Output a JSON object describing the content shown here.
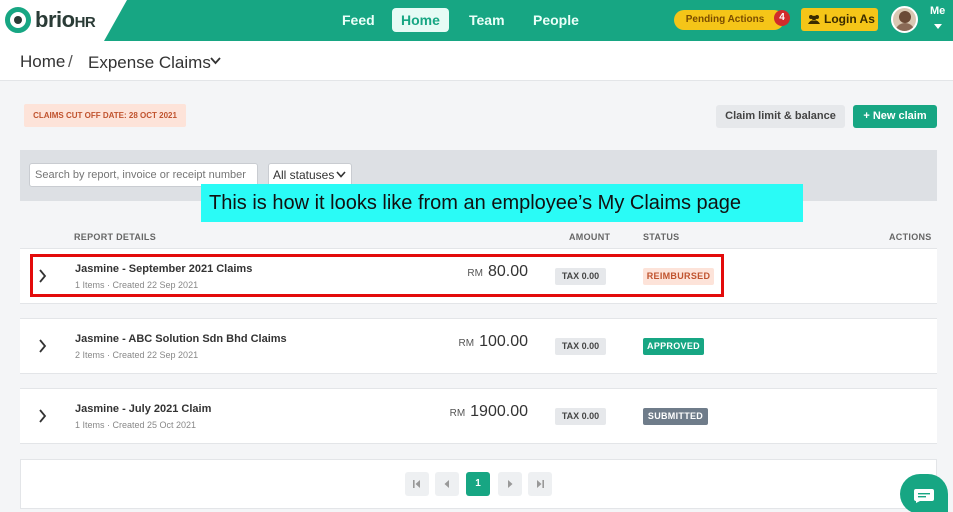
{
  "brand": {
    "name": "brio",
    "suffix": "HR"
  },
  "nav": {
    "feed": "Feed",
    "home": "Home",
    "team": "Team",
    "people": "People"
  },
  "header": {
    "pending_label": "Pending Actions",
    "pending_count": "4",
    "login_as": "Login As",
    "me": "Me"
  },
  "breadcrumb": {
    "home": "Home",
    "sep": "/",
    "page": "Expense Claims"
  },
  "toolbar": {
    "cutoff": "CLAIMS CUT OFF DATE: 28 OCT 2021",
    "limit_button": "Claim limit & balance",
    "new_button": "+ New claim"
  },
  "filter": {
    "search_placeholder": "Search by report, invoice or receipt number",
    "status_value": "All statuses"
  },
  "callout": "This is how it looks like from an employee’s My Claims page",
  "table": {
    "headers": {
      "details": "REPORT DETAILS",
      "amount": "AMOUNT",
      "status": "STATUS",
      "actions": "ACTIONS"
    },
    "rows": [
      {
        "title": "Jasmine - September 2021 Claims",
        "sub": "1 Items · Created 22 Sep 2021",
        "currency": "RM",
        "amount": "80.00",
        "tax": "TAX 0.00",
        "status": "REIMBURSED"
      },
      {
        "title": "Jasmine - ABC Solution Sdn Bhd Claims",
        "sub": "2 Items · Created 22 Sep 2021",
        "currency": "RM",
        "amount": "100.00",
        "tax": "TAX 0.00",
        "status": "APPROVED"
      },
      {
        "title": "Jasmine - July 2021 Claim",
        "sub": "1 Items · Created 25 Oct 2021",
        "currency": "RM",
        "amount": "1900.00",
        "tax": "TAX 0.00",
        "status": "SUBMITTED"
      }
    ]
  },
  "pagination": {
    "current": "1"
  },
  "colors": {
    "brand": "#17a683",
    "reimbursed_bg": "#fde3d9",
    "reimbursed_fg": "#c0532e",
    "approved": "#17a683",
    "submitted": "#6f7c8a",
    "highlight": "#e30b0b",
    "callout": "#2afbf6"
  }
}
